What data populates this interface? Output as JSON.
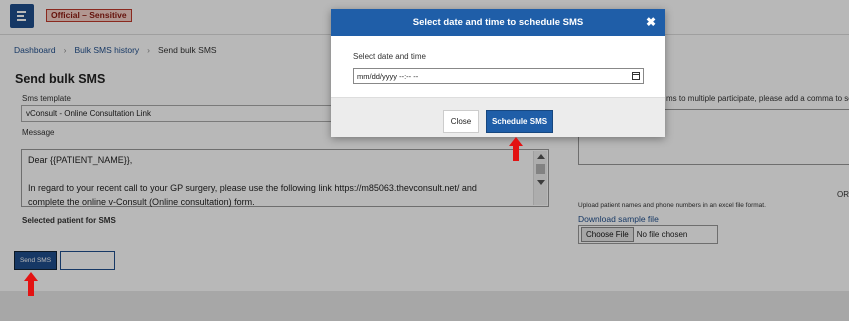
{
  "header": {
    "classification_badge": "Official – Sensitive"
  },
  "breadcrumb": {
    "items": [
      "Dashboard",
      "Bulk SMS history",
      "Send bulk SMS"
    ]
  },
  "form": {
    "page_title": "Send bulk SMS",
    "template_label": "Sms template",
    "template_value": "vConsult - Online Consultation Link",
    "message_label": "Message",
    "message_lines": [
      "Dear {{PATIENT_NAME}},",
      "",
      "In regard to your recent call to your GP surgery, please use the following link https://m85063.thevconsult.net/ and",
      "complete the online v-Consult (Online consultation) form."
    ],
    "selected_patient_label": "Selected patient for SMS",
    "send_button": "Send SMS"
  },
  "right_panel": {
    "hint": "ms to multiple participate, please add a comma to se",
    "or_label": "OR",
    "upload_hint": "Upload patient names and phone numbers in an excel file format.",
    "download_link": "Download sample file",
    "file_button": "Choose File",
    "file_status": "No file chosen"
  },
  "modal": {
    "title": "Select date and time to schedule SMS",
    "close_glyph": "✖",
    "field_label": "Select date and time",
    "input_placeholder": "mm/dd/yyyy --:-- --",
    "close_button": "Close",
    "schedule_button": "Schedule SMS"
  },
  "colors": {
    "primary": "#1f5ea8",
    "nav_blue": "#1f4e8c",
    "arrow_red": "#e31212",
    "badge_border": "#c0392b"
  },
  "icons": {
    "menu": "hamburger-menu-icon",
    "calendar": "calendar-icon",
    "close": "close-icon",
    "annotation": "red-arrow-up"
  }
}
